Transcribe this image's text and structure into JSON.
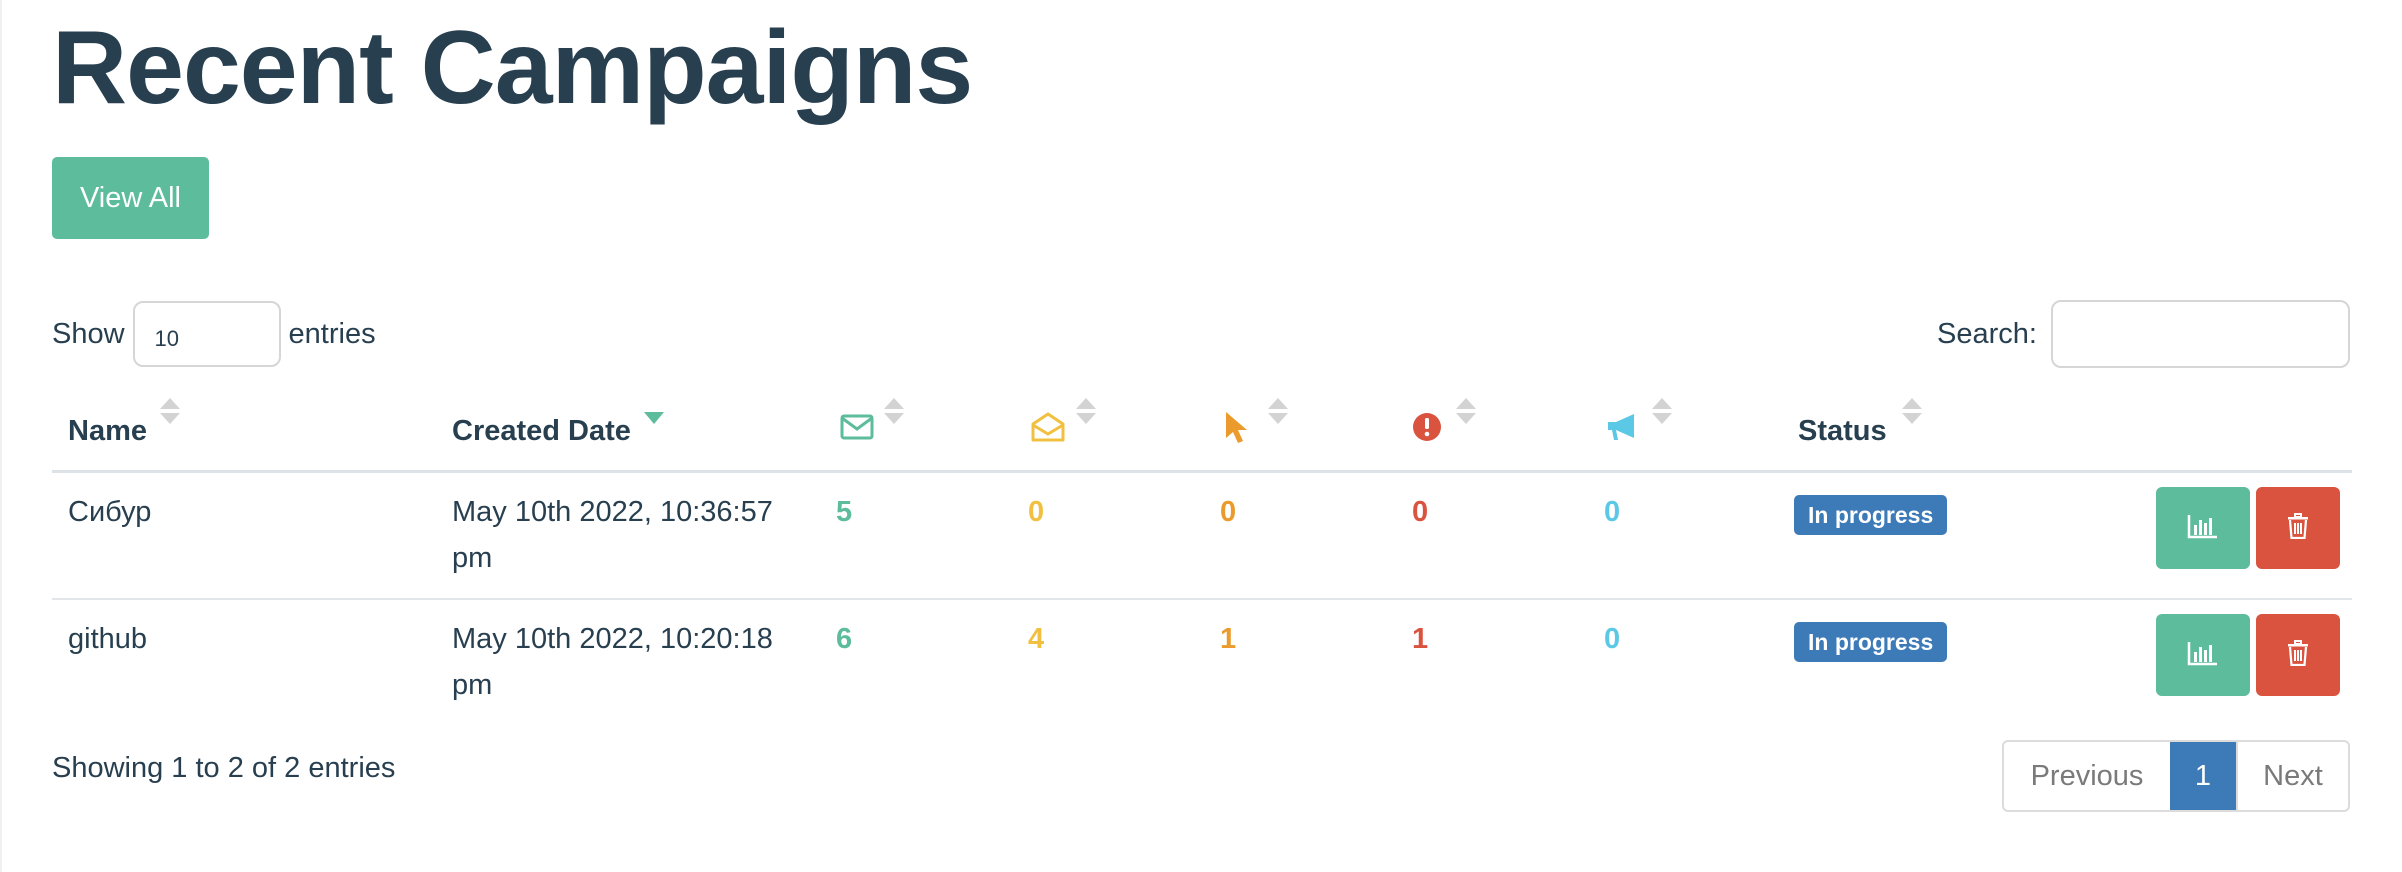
{
  "title": "Recent Campaigns",
  "view_all_label": "View All",
  "length": {
    "show": "Show",
    "value": "10",
    "entries": "entries"
  },
  "search": {
    "label": "Search:",
    "value": ""
  },
  "columns": {
    "name": "Name",
    "created": "Created Date",
    "sent_icon": "envelope-icon",
    "opened_icon": "envelope-open-icon",
    "clicked_icon": "cursor-pointer-icon",
    "submitted_icon": "exclamation-circle-icon",
    "reported_icon": "bullhorn-icon",
    "status": "Status"
  },
  "colors": {
    "sent": "#5cbc9b",
    "opened": "#f1c040",
    "clicked": "#eb9a2c",
    "submitted": "#d9533f",
    "reported": "#5bc8e6",
    "status_badge": "#3d7ab8",
    "stats_button": "#5cbc9b",
    "delete_button": "#d9533f"
  },
  "rows": [
    {
      "name": "Сибур",
      "created_line1": "May 10th 2022, 10:36:57",
      "created_line2": "pm",
      "sent": "5",
      "opened": "0",
      "clicked": "0",
      "submitted": "0",
      "reported": "0",
      "status": "In progress"
    },
    {
      "name": "github",
      "created_line1": "May 10th 2022, 10:20:18",
      "created_line2": "pm",
      "sent": "6",
      "opened": "4",
      "clicked": "1",
      "submitted": "1",
      "reported": "0",
      "status": "In progress"
    }
  ],
  "info": "Showing 1 to 2 of 2 entries",
  "pagination": {
    "previous": "Previous",
    "current": "1",
    "next": "Next"
  }
}
